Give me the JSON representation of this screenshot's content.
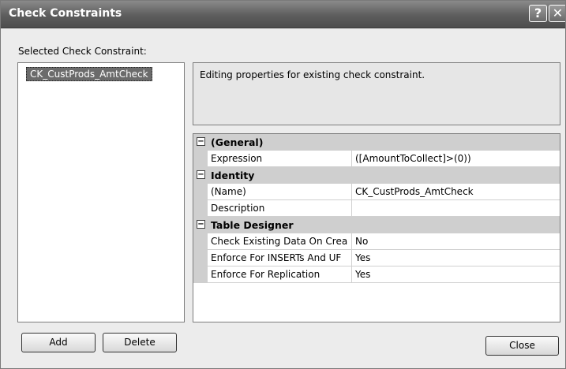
{
  "window": {
    "title": "Check Constraints",
    "help_label": "?",
    "close_label": "✕"
  },
  "left_panel": {
    "label": "Selected Check Constraint:",
    "items": [
      "CK_CustProds_AmtCheck"
    ]
  },
  "description": "Editing properties for existing check constraint.",
  "grid": {
    "rows": [
      {
        "type": "category",
        "label": "(General)",
        "toggle": "⊟"
      },
      {
        "type": "property",
        "name": "Expression",
        "value": "([AmountToCollect]>(0))"
      },
      {
        "type": "category",
        "label": "Identity",
        "toggle": "⊟"
      },
      {
        "type": "property",
        "name": "(Name)",
        "value": "CK_CustProds_AmtCheck"
      },
      {
        "type": "property",
        "name": "Description",
        "value": ""
      },
      {
        "type": "category",
        "label": "Table Designer",
        "toggle": "⊟"
      },
      {
        "type": "property",
        "name": "Check Existing Data On Crea",
        "value": "No"
      },
      {
        "type": "property",
        "name": "Enforce For INSERTs And UF",
        "value": "Yes"
      },
      {
        "type": "property",
        "name": "Enforce For Replication",
        "value": "Yes"
      }
    ]
  },
  "buttons": {
    "add": "Add",
    "delete": "Delete",
    "close": "Close"
  }
}
